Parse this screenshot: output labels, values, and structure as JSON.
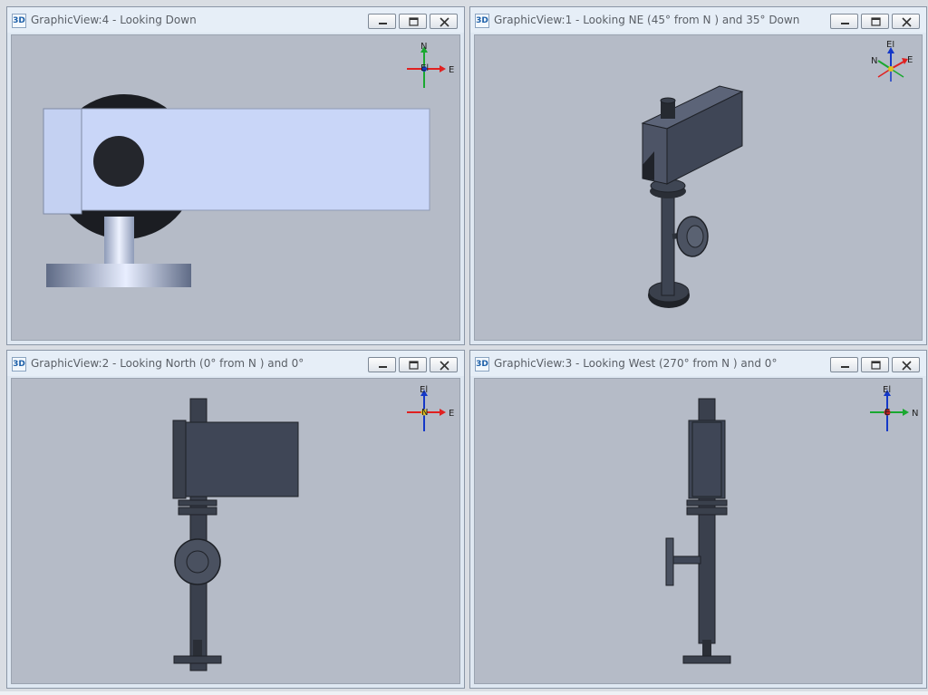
{
  "panes": [
    {
      "id": "view4",
      "icon": "3D",
      "title": "GraphicView:4 - Looking Down",
      "axes": {
        "top": "N",
        "right": "E",
        "center": "El"
      }
    },
    {
      "id": "view1",
      "icon": "3D",
      "title": "GraphicView:1 - Looking NE (45° from N ) and 35° Down",
      "axes": {
        "top": "El",
        "left": "N",
        "right": "E"
      }
    },
    {
      "id": "view2",
      "icon": "3D",
      "title": "GraphicView:2 - Looking North (0° from N ) and 0°",
      "axes": {
        "top": "El",
        "right": "E",
        "center": "N"
      }
    },
    {
      "id": "view3",
      "icon": "3D",
      "title": "GraphicView:3 - Looking West (270° from N ) and 0°",
      "axes": {
        "top": "El",
        "right": "N",
        "center": "E"
      }
    }
  ],
  "colors": {
    "viewport_bg": "#b5bbc7",
    "model_light": "#c9d6f8",
    "model_dark": "#3f4654",
    "axis_x": "#e02020",
    "axis_y": "#1aa830",
    "axis_z": "#1438c8"
  }
}
